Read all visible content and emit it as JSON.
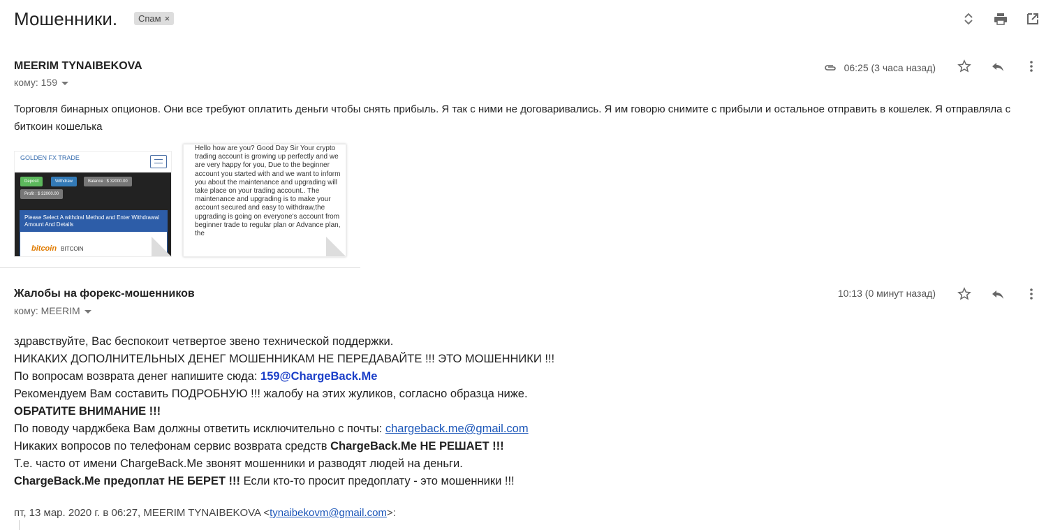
{
  "thread": {
    "subject": "Мошенники.",
    "label": "Спам",
    "label_remove": "×",
    "icons": [
      "expand-collapse-icon",
      "print-icon",
      "open-new-window-icon"
    ]
  },
  "message1": {
    "sender": "MEERIM TYNAIBEKOVA",
    "to": "кому: 159",
    "time": "06:25 (3 часа назад)",
    "body": "Торговля бинарных опционов. Они все требуют оплатить деньги чтобы снять прибыль. Я так с ними не договаривались. Я им говорю снимите с прибыли и остальное отправить в кошелек. Я отправляла с биткоин кошелька",
    "attachment1": {
      "site_title": "GOLDEN FX TRADE",
      "deposit": "Deposit",
      "withdraw": "Withdraw",
      "balance": "Balance : $ 32000.00",
      "profit": "Profit : $ 32000.00",
      "panel_heading": "Please Select A withdral Method and Enter Withdrawal Amount And Details",
      "bitcoin": "bitcoin",
      "bitcoin_label": "BITCOIN"
    },
    "attachment2": {
      "text": "Hello how are you? Good Day Sir Your crypto trading account is growing up perfectly and we are very happy for you, Due to the beginner account you started with and we want to inform you about the maintenance and upgrading will take place on your trading account.. The maintenance and upgrading is to make your account secured and easy to withdraw,the upgrading is going on everyone's account from beginner trade to regular plan or Advance plan, the"
    }
  },
  "message2": {
    "sender": "Жалобы на форекс-мошенников",
    "to": "кому: MEERIM",
    "time": "10:13 (0 минут назад)",
    "line1": "здравствуйте, Вас беспокоит четвертое звено технической поддержки.",
    "line2": "НИКАКИХ ДОПОЛНИТЕЛЬНЫХ ДЕНЕГ МОШЕННИКАМ НЕ ПЕРЕДАВАЙТЕ !!! ЭТО МОШЕННИКИ !!!",
    "line3_prefix": "По вопросам возврата денег напишите сюда: ",
    "line3_email": "159@ChargeBack.Me",
    "line4": "Рекомендуем Вам составить ПОДРОБНУЮ !!! жалобу на этих жуликов, согласно образца ниже.",
    "line5": "ОБРАТИТЕ ВНИМАНИЕ !!!",
    "line6_prefix": "По поводу чарджбека Вам должны ответить исключительно с почты: ",
    "line6_email": "chargeback.me@gmail.com",
    "line7_prefix": "Никаких вопросов по телефонам сервис возврата средств ",
    "line7_bold": "ChargeBack.Me НЕ РЕШАЕТ !!!",
    "line8": "Т.е. часто от имени ChargeBack.Me звонят мошенники и разводят людей на деньги.",
    "line9_bold": "ChargeBack.Me предоплат НЕ БЕРЕТ !!!",
    "line9_rest": " Если кто-то просит предоплату - это мошенники !!!",
    "quote_prefix": "пт, 13 мар. 2020 г. в 06:27, MEERIM TYNAIBEKOVA <",
    "quote_email": "tynaibekovm@gmail.com",
    "quote_suffix": ">:"
  }
}
